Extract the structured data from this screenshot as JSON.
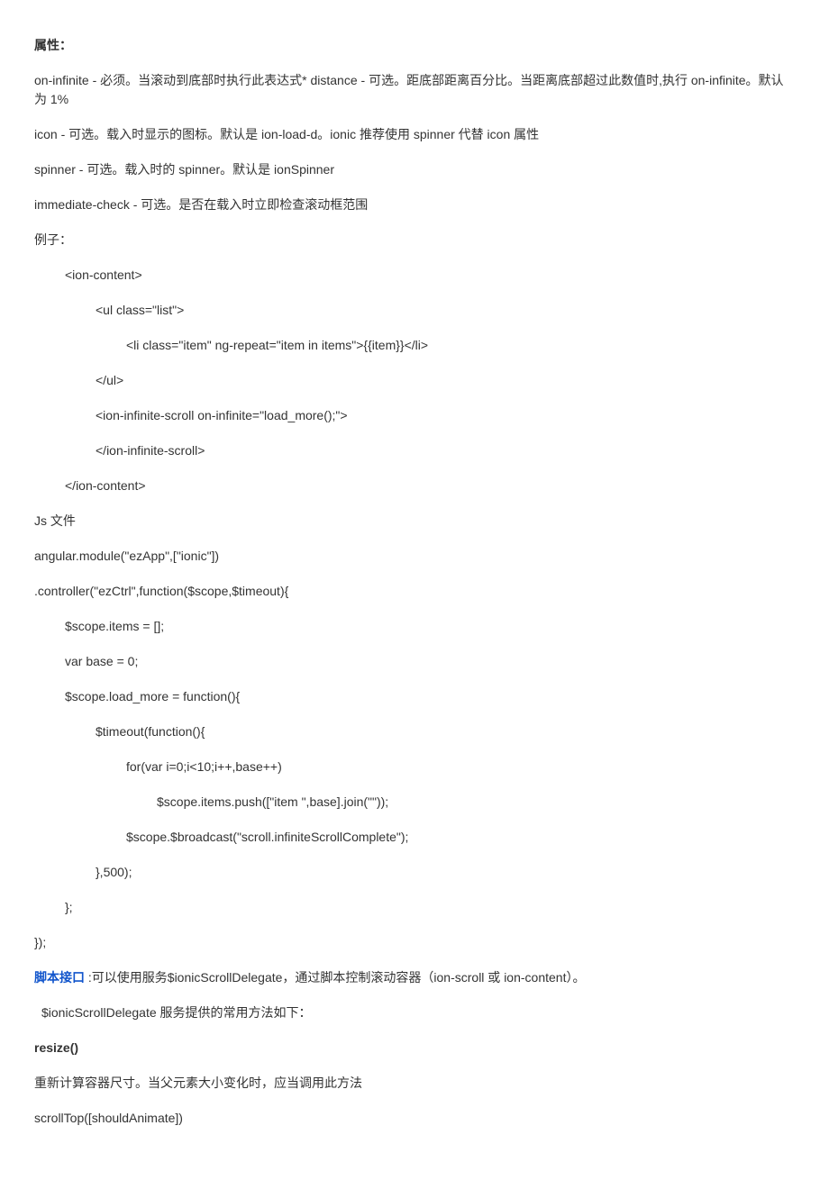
{
  "p1": "属性：",
  "p2": "on-infinite -  必须。当滚动到底部时执行此表达式* distance -  可选。距底部距离百分比。当距离底部超过此数值时,执行 on-infinite。默认为 1%",
  "p3": "icon -  可选。载入时显示的图标。默认是 ion-load-d。ionic 推荐使用 spinner 代替 icon 属性",
  "p4": "spinner -  可选。载入时的 spinner。默认是 ionSpinner",
  "p5": "immediate-check -  可选。是否在载入时立即检查滚动框范围",
  "p6": "例子：",
  "p7": "<ion-content>",
  "p8": "<ul class=\"list\">",
  "p9": "<li class=\"item\"    ng-repeat=\"item in items\">{{item}}</li>",
  "p10": "</ul>",
  "p11": "<ion-infinite-scroll on-infinite=\"load_more();\">",
  "p12": "</ion-infinite-scroll>",
  "p13": "</ion-content>",
  "p14": "Js 文件",
  "p15": "angular.module(\"ezApp\",[\"ionic\"])",
  "p16": ".controller(\"ezCtrl\",function($scope,$timeout){",
  "p17": "$scope.items = [];",
  "p18": "var base = 0;",
  "p19": "$scope.load_more = function(){",
  "p20": "$timeout(function(){",
  "p21": "for(var i=0;i<10;i++,base++)",
  "p22": "$scope.items.push([\"item \",base].join(\"\"));",
  "p23": "$scope.$broadcast(\"scroll.infiniteScrollComplete\");",
  "p24": "},500);",
  "p25": "};",
  "p26": "});",
  "p27a": "脚本接口",
  "p27b": " :可以使用服务$ionicScrollDelegate，通过脚本控制滚动容器（ion-scroll 或 ion-content）。",
  "p28": "$ionicScrollDelegate 服务提供的常用方法如下：",
  "p29": "resize()",
  "p30": "重新计算容器尺寸。当父元素大小变化时，应当调用此方法",
  "p31": "scrollTop([shouldAnimate])"
}
